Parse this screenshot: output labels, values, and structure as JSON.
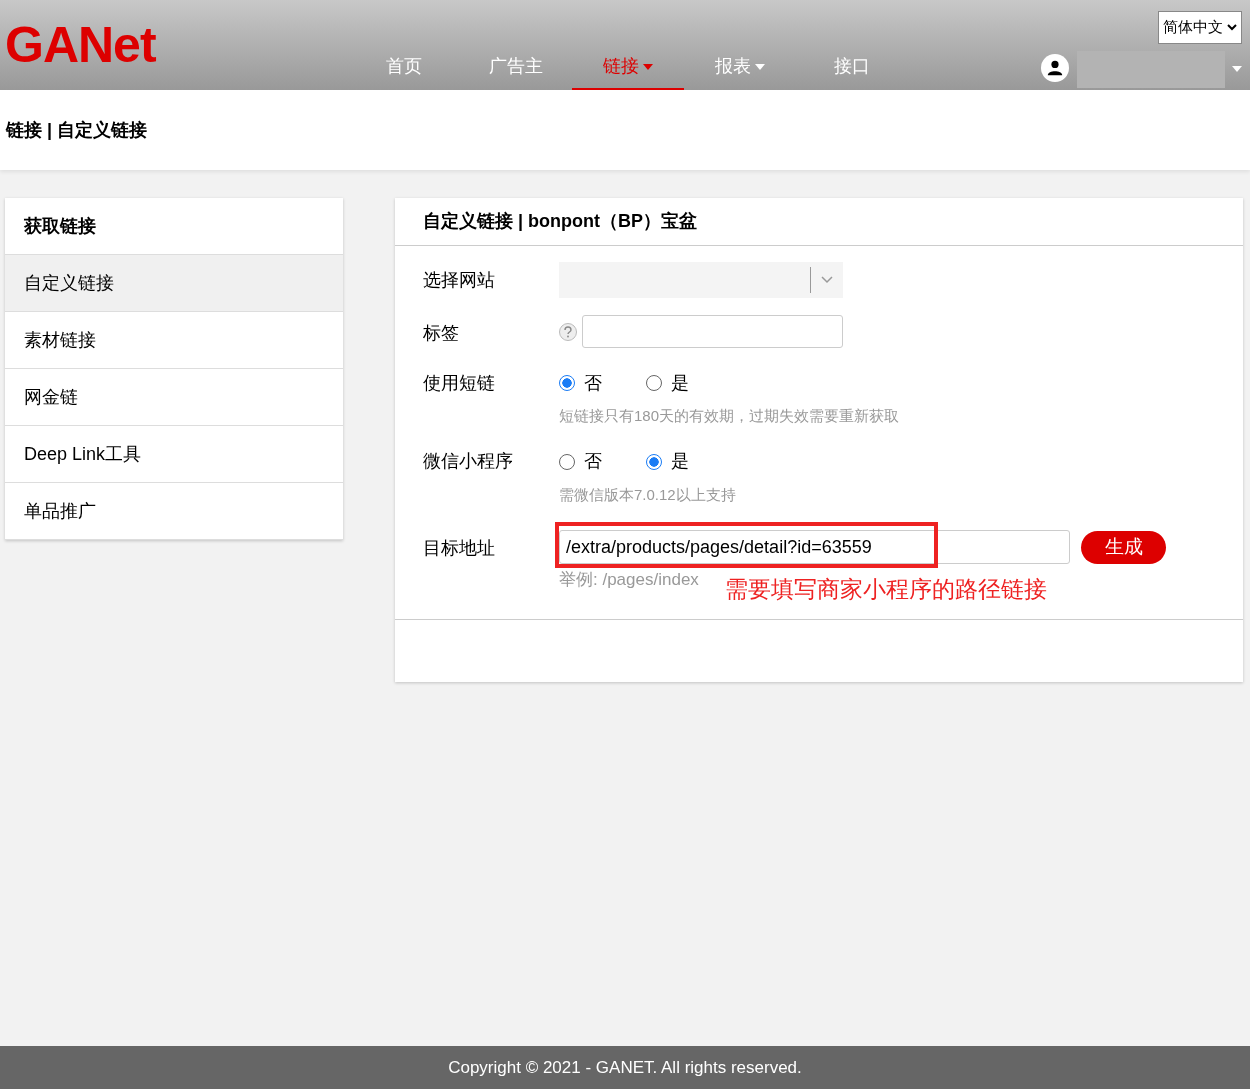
{
  "logo": {
    "text": "GANet"
  },
  "nav": [
    {
      "label": "首页",
      "selected": false,
      "dropdown": false
    },
    {
      "label": "广告主",
      "selected": false,
      "dropdown": false
    },
    {
      "label": "链接",
      "selected": true,
      "dropdown": true
    },
    {
      "label": "报表",
      "selected": false,
      "dropdown": true
    },
    {
      "label": "接口",
      "selected": false,
      "dropdown": false
    }
  ],
  "language": "简体中文",
  "breadcrumb": "链接 | 自定义链接",
  "sidebar": {
    "title": "获取链接",
    "items": [
      {
        "label": "自定义链接",
        "selected": true
      },
      {
        "label": "素材链接",
        "selected": false
      },
      {
        "label": "网金链",
        "selected": false
      },
      {
        "label": "Deep Link工具",
        "selected": false
      },
      {
        "label": "单品推广",
        "selected": false
      }
    ]
  },
  "panel": {
    "title": "自定义链接 | bonpont（BP）宝盆",
    "fields": [
      {
        "kind": "select",
        "label": "选择网站"
      },
      {
        "kind": "text",
        "label": "标签"
      },
      {
        "kind": "radio",
        "label": "使用短链",
        "options": [
          {
            "label": "否",
            "selected": true
          },
          {
            "label": "是",
            "selected": false
          }
        ],
        "hint": "短链接只有180天的有效期，过期失效需要重新获取"
      },
      {
        "kind": "radio",
        "label": "微信小程序",
        "options": [
          {
            "label": "否",
            "selected": false
          },
          {
            "label": "是",
            "selected": true
          }
        ],
        "hint": "需微信版本7.0.12以上支持"
      },
      {
        "kind": "url",
        "label": "目标地址",
        "value": "/extra/products/pages/detail?id=63559",
        "hint": "举例: /pages/index",
        "button": "生成",
        "annotation": "需要填写商家小程序的路径链接"
      }
    ]
  },
  "footer": "Copyright © 2021 - GANET. All rights reserved."
}
